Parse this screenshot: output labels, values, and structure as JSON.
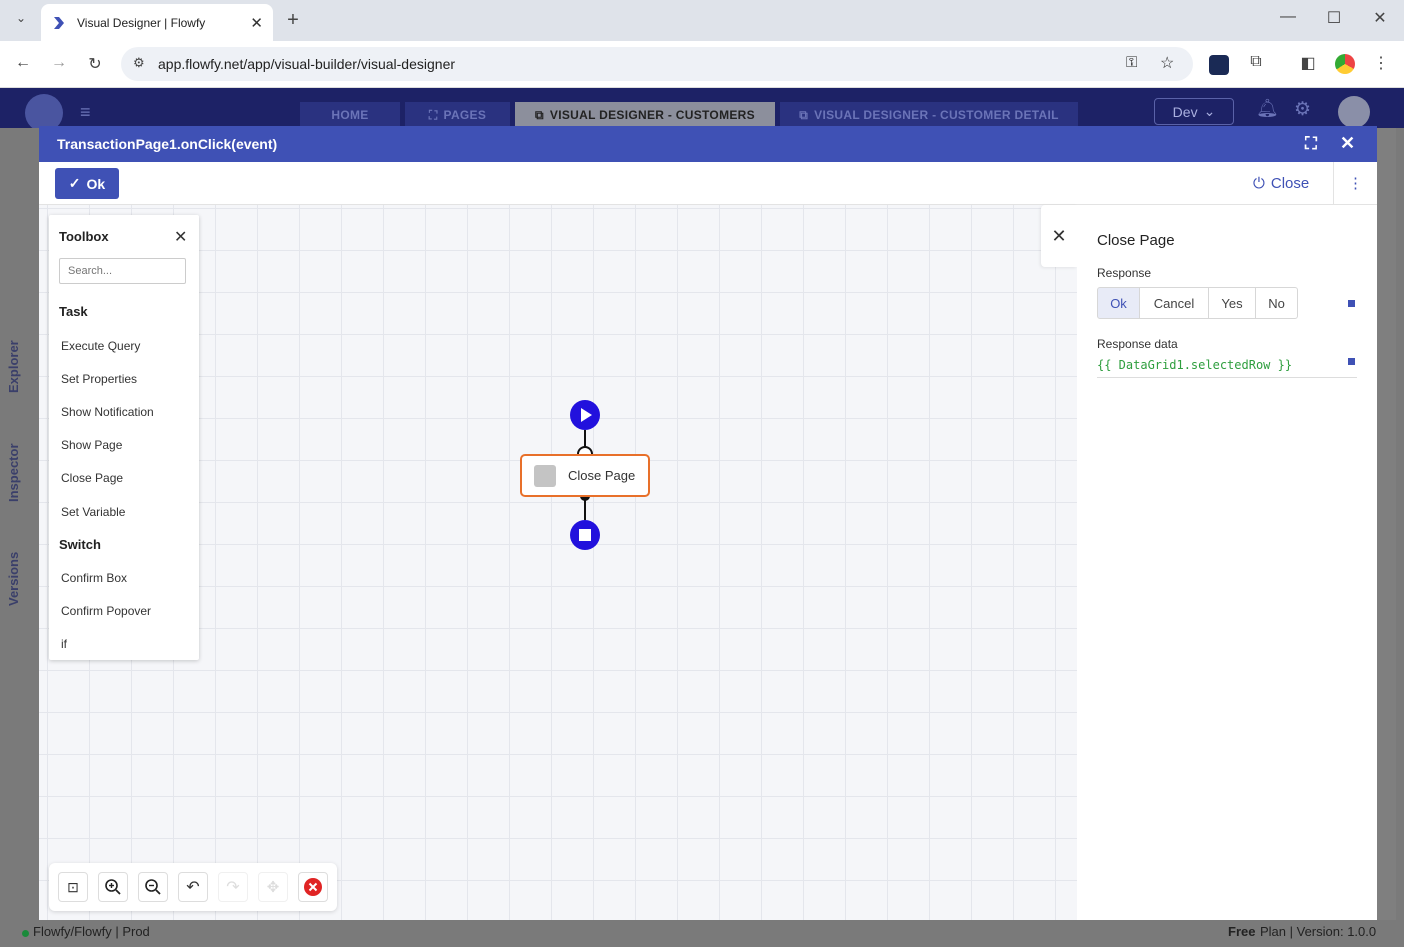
{
  "browser": {
    "tab_title": "Visual Designer | Flowfy",
    "url": "app.flowfy.net/app/visual-builder/visual-designer"
  },
  "app": {
    "tabs": [
      "HOME",
      "PAGES",
      "VISUAL DESIGNER - CUSTOMERS",
      "VISUAL DESIGNER - CUSTOMER DETAIL"
    ],
    "env": "Dev",
    "side_tabs": [
      "Explorer",
      "Inspector",
      "Versions"
    ],
    "status_left": "Flowfy/Flowfy | Prod",
    "status_plan_bold": "Free",
    "status_right": "Plan | Version: 1.0.0"
  },
  "dialog": {
    "title": "TransactionPage1.onClick(event)",
    "ok_label": "Ok",
    "close_label": "Close"
  },
  "toolbox": {
    "title": "Toolbox",
    "search_placeholder": "Search...",
    "sections": [
      {
        "title": "Task",
        "items": [
          "Execute Query",
          "Set Properties",
          "Show Notification",
          "Show Page",
          "Close Page",
          "Set Variable"
        ]
      },
      {
        "title": "Switch",
        "items": [
          "Confirm Box",
          "Confirm Popover",
          "if"
        ]
      }
    ]
  },
  "flow": {
    "task_label": "Close Page"
  },
  "panel": {
    "title": "Close Page",
    "response_label": "Response",
    "response_options": [
      "Ok",
      "Cancel",
      "Yes",
      "No"
    ],
    "response_selected": "Ok",
    "response_data_label": "Response data",
    "response_data_value": "{{ DataGrid1.selectedRow }}"
  },
  "colors": {
    "accent": "#3f51b5",
    "node": "#2211dd",
    "task_border": "#e8702a",
    "code": "#2e9e3e",
    "danger": "#e02424"
  }
}
